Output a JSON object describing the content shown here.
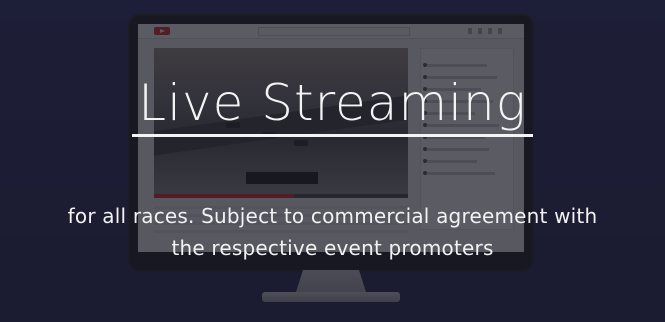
{
  "slide": {
    "title": "Live Streaming",
    "caption_line1": "for all races. Subject to commercial agreement with",
    "caption_line2": "the respective event promoters"
  },
  "colors": {
    "background": "#1c1f4e",
    "overlay": "#1c1c28",
    "text": "#f4f4f4",
    "video_player_accent": "#e02020"
  },
  "icons": {
    "player_logo": "play-logo-icon"
  },
  "video_progress_fraction": 0.55
}
